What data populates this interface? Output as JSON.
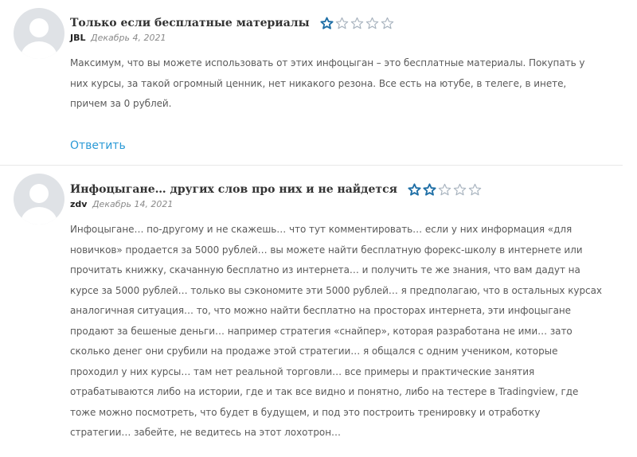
{
  "comments": [
    {
      "title": "Только если бесплатные материалы",
      "rating": 1,
      "author": "JBL",
      "date": "Декабрь 4, 2021",
      "text_lines": [
        "Максимум, что вы можете использовать от этих инфоцыган – это бесплатные материалы. Покупать у",
        "них курсы, за такой огромный ценник, нет никакого резона. Все есть на ютубе, в телеге, в инете,",
        "причем за 0 рублей."
      ],
      "reply_label": "Ответить"
    },
    {
      "title": "Инфоцыгане… других слов про них и не найдется",
      "rating": 2,
      "author": "zdv",
      "date": "Декабрь 14, 2021",
      "text_lines": [
        "Инфоцыгане… по-другому и не скажешь… что тут комментировать… если у них информация «для",
        "новичков» продается за 5000 рублей… вы можете найти бесплатную форекс-школу в интернете или",
        "прочитать книжку, скачанную бесплатно из интернета… и получить те же знания, что вам дадут на",
        "курсе за 5000 рублей… только вы сэкономите эти 5000 рублей… я предполагаю, что в остальных курсах",
        "аналогичная ситуация… то, что можно найти бесплатно на просторах интернета, эти инфоцыгане",
        "продают за бешеные деньги… например стратегия «снайпер», которая разработана не ими… зато",
        "сколько денег они срубили на продаже этой стратегии… я общался с одним учеником, которые",
        "проходил у них курсы… там нет реальной торговли… все примеры и практические занятия",
        "отрабатываются либо на истории, где и так все видно и понятно, либо на тестере в Tradingview, где",
        "тоже можно посмотреть, что будет в будущем, и под это построить тренировку и отработку",
        "стратегии… забейте, не ведитесь на этот лохотрон…"
      ]
    }
  ],
  "stars_total": 5,
  "colors": {
    "star": "#1f6fa6",
    "link": "#2b9ad6",
    "avatar_bg": "#dfe2e6",
    "avatar_fg": "#ffffff"
  },
  "icons": {
    "avatar": "user-silhouette-icon",
    "star": "star-icon"
  }
}
